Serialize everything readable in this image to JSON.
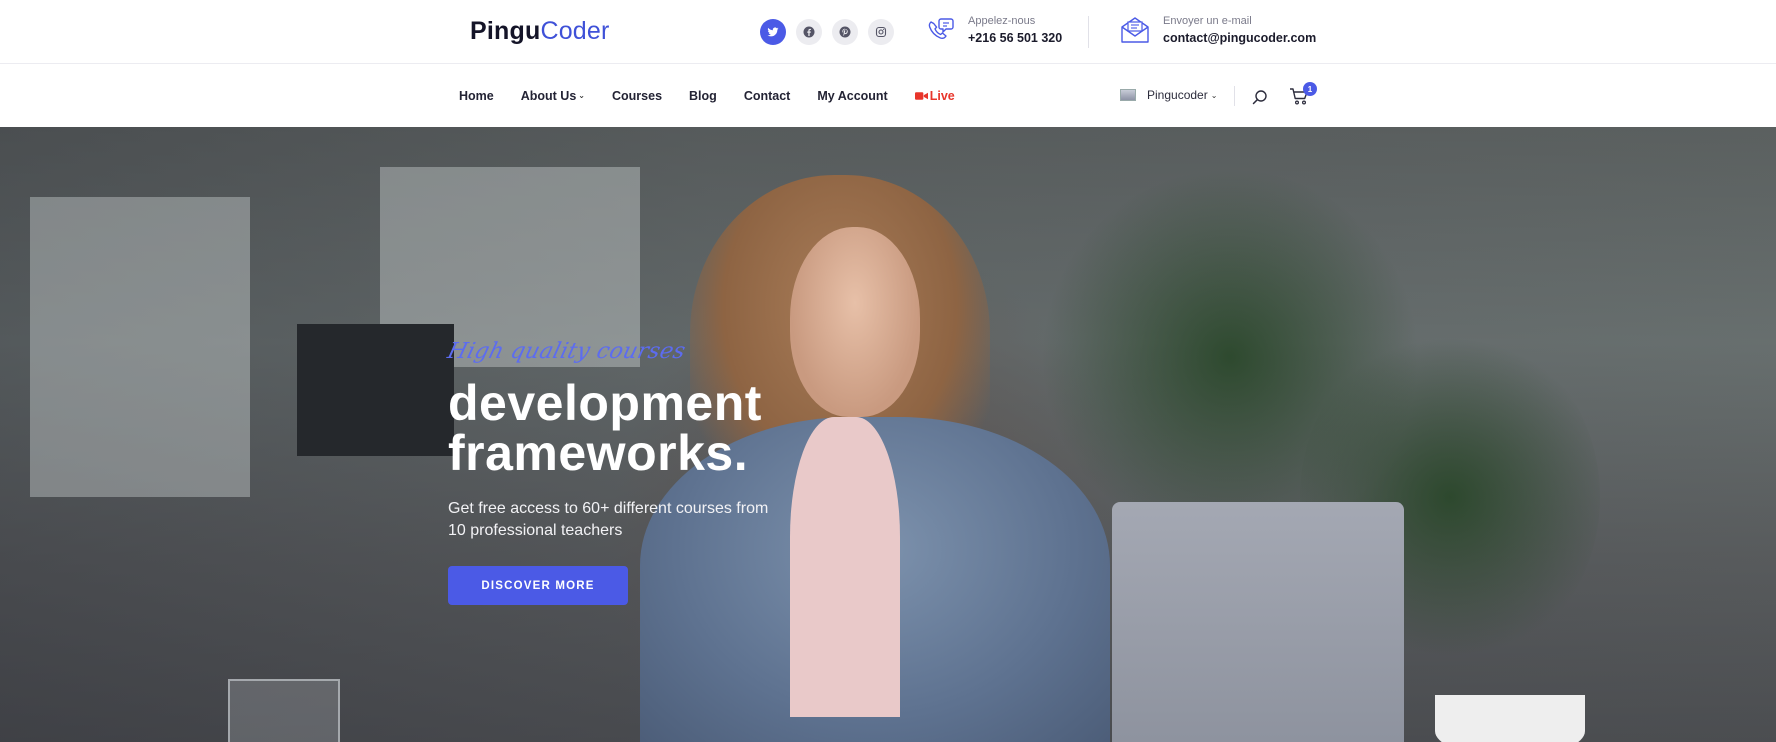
{
  "brand": {
    "part1": "Pingu",
    "part2": "Coder"
  },
  "socials": [
    {
      "name": "twitter",
      "icon": "twitter-icon",
      "active": true
    },
    {
      "name": "facebook",
      "icon": "facebook-icon",
      "active": false
    },
    {
      "name": "pinterest",
      "icon": "pinterest-icon",
      "active": false
    },
    {
      "name": "instagram",
      "icon": "instagram-icon",
      "active": false
    }
  ],
  "contact": {
    "phone": {
      "label": "Appelez-nous",
      "value": "+216 56 501 320",
      "icon": "phone-chat-icon"
    },
    "email": {
      "label": "Envoyer un e-mail",
      "value": "contact@pingucoder.com",
      "icon": "envelope-icon"
    }
  },
  "nav": {
    "items": [
      {
        "label": "Home"
      },
      {
        "label": "About Us",
        "dropdown": true
      },
      {
        "label": "Courses"
      },
      {
        "label": "Blog"
      },
      {
        "label": "Contact"
      },
      {
        "label": "My Account"
      },
      {
        "label": "Live",
        "icon": "video-camera-icon"
      }
    ],
    "user": {
      "name": "Pingucoder"
    },
    "cart_count": "1"
  },
  "hero": {
    "tagline": "High quality courses",
    "headline_line1": "development",
    "headline_line2": "frameworks.",
    "subtext_line1": "Get free access to 60+ different courses from",
    "subtext_line2": "10 professional teachers",
    "cta_label": "DISCOVER MORE"
  },
  "colors": {
    "accent": "#4b5ae6",
    "live": "#e8352b",
    "text_dark": "#1f1f2e"
  }
}
